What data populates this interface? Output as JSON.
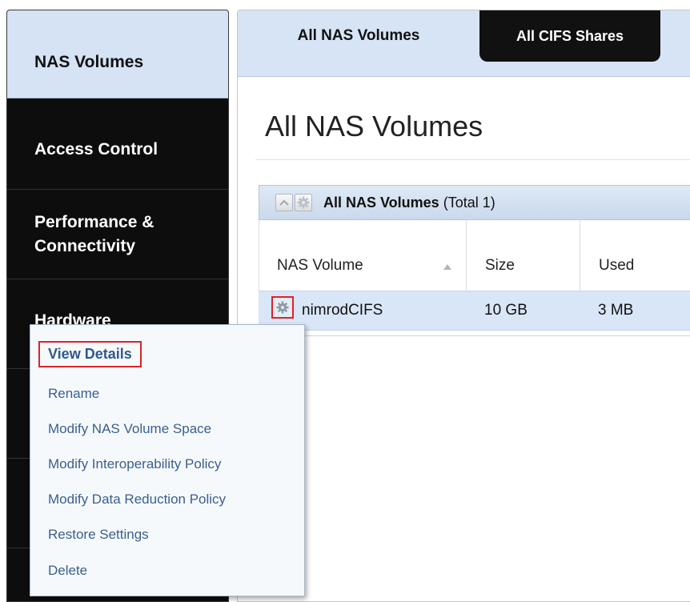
{
  "sidebar": {
    "items": [
      {
        "label": "NAS Volumes",
        "active": true
      },
      {
        "label": "Access Control"
      },
      {
        "label": "Performance &\nConnectivity"
      },
      {
        "label": "Hardware"
      },
      {
        "label": ""
      },
      {
        "label": ""
      }
    ]
  },
  "tabs": {
    "active": "All NAS Volumes",
    "inactive": "All CIFS Shares"
  },
  "page": {
    "title": "All NAS Volumes"
  },
  "grid": {
    "title": "All NAS Volumes",
    "total": "(Total  1)",
    "columns": [
      "NAS Volume",
      "Size",
      "Used"
    ],
    "rows": [
      {
        "name": "nimrodCIFS",
        "size": "10 GB",
        "used": "3 MB"
      }
    ]
  },
  "context_menu": {
    "items": [
      "View Details",
      "Rename",
      "Modify NAS Volume Space",
      "Modify Interoperability Policy",
      "Modify Data Reduction Policy",
      "Restore Settings",
      "Delete"
    ]
  },
  "colors": {
    "sidebar_bg": "#0d0d0d",
    "active_bg": "#d5e3f5",
    "menu_link": "#395f8d",
    "highlight_border": "#d8232a"
  }
}
